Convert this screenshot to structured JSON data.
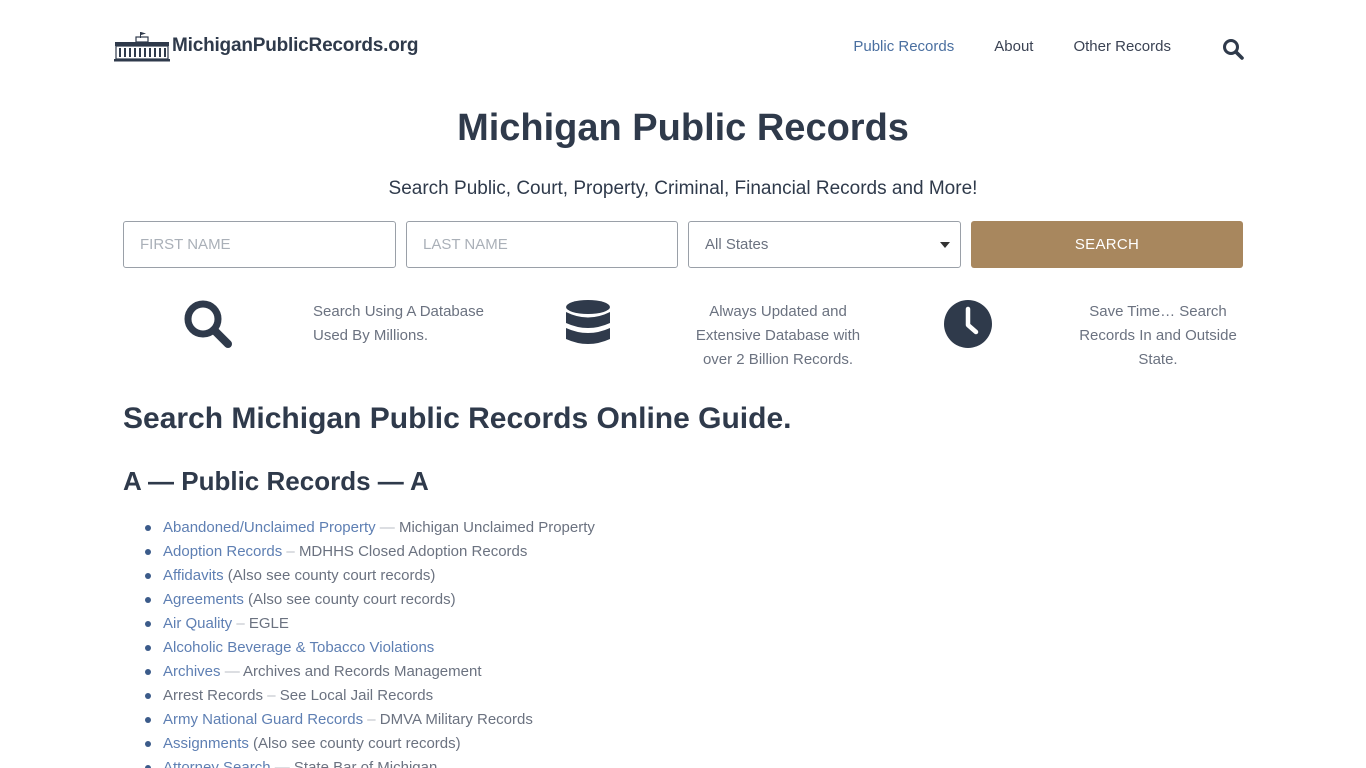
{
  "header": {
    "site_name": "MichiganPublicRecords.org",
    "nav": [
      {
        "label": "Public Records",
        "active": true
      },
      {
        "label": "About",
        "active": false
      },
      {
        "label": "Other Records",
        "active": false
      }
    ]
  },
  "hero": {
    "title": "Michigan Public Records",
    "subtitle": "Search Public, Court, Property, Criminal, Financial Records and More!"
  },
  "search": {
    "first_name_placeholder": "FIRST NAME",
    "last_name_placeholder": "LAST NAME",
    "state_value": "All States",
    "button_label": "SEARCH"
  },
  "features": [
    {
      "icon": "magnifier-icon",
      "line1": "Search Using A Database",
      "line2": "Used By Millions.",
      "line3": ""
    },
    {
      "icon": "database-icon",
      "line1": "Always Updated and",
      "line2": "Extensive Database with",
      "line3": "over 2 Billion Records."
    },
    {
      "icon": "clock-icon",
      "line1": "Save Time… Search",
      "line2": "Records In and Outside",
      "line3": "State."
    }
  ],
  "guide": {
    "title": "Search Michigan Public Records Online Guide.",
    "section_title": "A — Public Records — A",
    "items": [
      {
        "link": "Abandoned/Unclaimed Property",
        "sep": " — ",
        "desc": "Michigan Unclaimed Property"
      },
      {
        "link": "Adoption Records",
        "sep": " – ",
        "desc": "MDHHS Closed Adoption Records"
      },
      {
        "link": "Affidavits",
        "sep": " ",
        "desc": "(Also see county court records)"
      },
      {
        "link": "Agreements",
        "sep": " ",
        "desc": "(Also see county court records)"
      },
      {
        "link": "Air Quality",
        "sep": " – ",
        "desc": "EGLE"
      },
      {
        "link": "Alcoholic Beverage & Tobacco Violations",
        "sep": "",
        "desc": ""
      },
      {
        "link": "Archives",
        "sep": " — ",
        "desc": "Archives and Records Management"
      },
      {
        "link": "Arrest Records",
        "sep": " – ",
        "desc": "See Local Jail Records"
      },
      {
        "link": "Army National Guard Records",
        "sep": " – ",
        "desc": "DMVA Military Records"
      },
      {
        "link": "Assignments",
        "sep": " ",
        "desc": "(Also see county court records)"
      },
      {
        "link": "Attorney Search",
        "sep": " — ",
        "desc": "State Bar of Michigan"
      }
    ]
  }
}
